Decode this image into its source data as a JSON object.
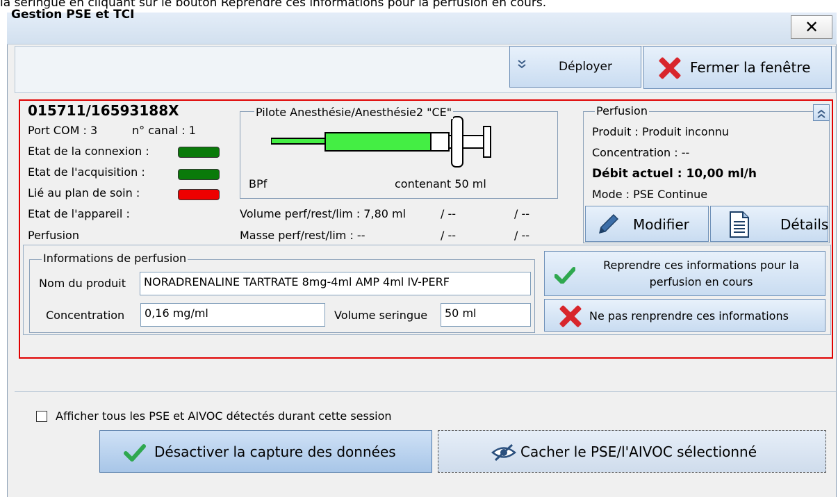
{
  "caption": "la seringue en cliquant sur le bouton Reprendre ces informations pour la perfusion en cours.",
  "window": {
    "title": "Gestion PSE et TCI",
    "close_glyph": "✕"
  },
  "toolbar": {
    "deployer_label": "Déployer",
    "fermer_label": "Fermer la fenêtre"
  },
  "device": {
    "id": "015711/16593188X",
    "port": "Port COM : 3",
    "canal": "n° canal : 1",
    "connexion_label": "Etat de la connexion :",
    "acquisition_label": "Etat de l'acquisition :",
    "lie_label": "Lié au plan de soin :",
    "appareil_label": "Etat de l'appareil :",
    "perfusion_label": "Perfusion",
    "status_colors": {
      "connexion": "#0a7a0a",
      "acquisition": "#0a7a0a",
      "lie": "#ee0000"
    }
  },
  "pilote": {
    "title": "Pilote Anesthésie/Anesthésie2 \"CE\"",
    "bpf": "BPf",
    "contenant": "contenant 50 ml",
    "syringe_fill_color": "#44ee44"
  },
  "volumes": {
    "volume_line": "Volume perf/rest/lim : 7,80 ml",
    "volume_rest": "/ --",
    "volume_lim": "/ --",
    "masse_line": "Masse perf/rest/lim : --",
    "masse_rest": "/ --",
    "masse_lim": "/ --"
  },
  "perfusion": {
    "title": "Perfusion",
    "produit": "Produit : Produit inconnu",
    "concentration": "Concentration : --",
    "debit": "Débit actuel : 10,00 ml/h",
    "mode": "Mode : PSE Continue",
    "modifier_label": "Modifier",
    "details_label": "Détails"
  },
  "info": {
    "title": "Informations de perfusion",
    "nom_label": "Nom du produit",
    "nom_value": "NORADRENALINE TARTRATE 8mg-4ml AMP 4ml IV-PERF",
    "conc_label": "Concentration",
    "conc_value": "0,16 mg/ml",
    "vol_label": "Volume seringue",
    "vol_value": "50 ml"
  },
  "actions": {
    "reprendre_line1": "Reprendre ces informations pour la",
    "reprendre_line2": "perfusion en cours",
    "ne_pas_label": "Ne pas renprendre ces informations"
  },
  "bottom": {
    "afficher_label": "Afficher tous les PSE et AIVOC détectés durant cette session",
    "desactiver_label": "Désactiver la capture des données",
    "cacher_label": "Cacher le PSE/l'AIVOC sélectionné"
  }
}
